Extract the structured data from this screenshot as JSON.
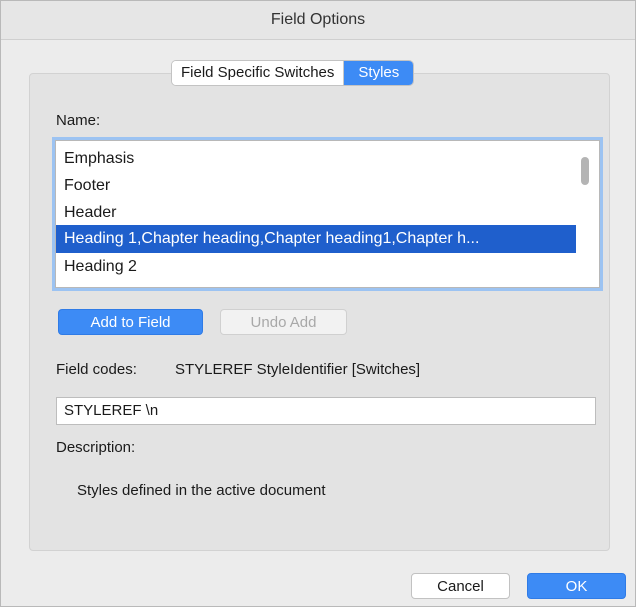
{
  "window": {
    "title": "Field Options"
  },
  "tabs": [
    {
      "label": "Field Specific Switches",
      "active": false
    },
    {
      "label": "Styles",
      "active": true
    }
  ],
  "name_label": "Name:",
  "styles_list": {
    "items": [
      "Emphasis",
      "Footer",
      "Header",
      "Heading 1,Chapter heading,Chapter heading1,Chapter h...",
      "Heading 2"
    ],
    "selected": "Heading 1,Chapter heading,Chapter heading1,Chapter h..."
  },
  "buttons": {
    "add_to_field": "Add to Field",
    "undo_add": "Undo Add",
    "cancel": "Cancel",
    "ok": "OK"
  },
  "field_codes": {
    "label": "Field codes:",
    "syntax": "STYLEREF StyleIdentifier [Switches]",
    "value": "STYLEREF \\n"
  },
  "description": {
    "label": "Description:",
    "text": "Styles defined in the active document"
  },
  "colors": {
    "accent": "#3d8bf5",
    "selection": "#1f5fcc"
  }
}
